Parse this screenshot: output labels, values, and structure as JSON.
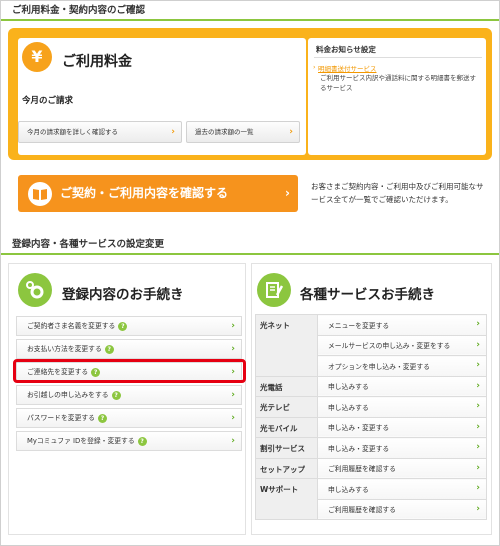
{
  "billing_section": {
    "title": "ご利用料金・契約内容のご確認",
    "card": {
      "icon": "yen-icon",
      "yen_symbol": "¥",
      "title": "ご利用料金",
      "subtitle": "今月のご請求",
      "buttons": [
        {
          "label": "今月の請求額を詳しく確認する"
        },
        {
          "label": "過去の請求額の一覧"
        }
      ]
    },
    "notice": {
      "title": "料金お知らせ設定",
      "link": "明細書送付サービス",
      "description": "ご利用サービス内訳や通話料に関する明細書を郵送するサービス"
    },
    "contract_button": {
      "label": "ご契約・ご利用内容を確認する",
      "icon": "book-icon"
    },
    "contract_note": "お客さまご契約内容・ご利用中及びご利用可能なサービス全てが一覧でご確認いただけます。"
  },
  "settings_section": {
    "title": "登録内容・各種サービスの設定変更",
    "registration": {
      "title": "登録内容のお手続き",
      "icon": "gear-icon",
      "help_mark": "?",
      "items": [
        {
          "label": "ご契約者さま名義を変更する"
        },
        {
          "label": "お支払い方法を変更する"
        },
        {
          "label": "ご連絡先を変更する"
        },
        {
          "label": "お引越しの申し込みをする"
        },
        {
          "label": "パスワードを変更する"
        },
        {
          "label": "Myコミュファ IDを登録・変更する"
        }
      ]
    },
    "services": {
      "title": "各種サービスお手続き",
      "icon": "pencil-note-icon",
      "groups": [
        {
          "name": "光ネット",
          "items": [
            "メニューを変更する",
            "メールサービスの申し込み・変更をする",
            "オプションを申し込み・変更する"
          ]
        },
        {
          "name": "光電話",
          "items": [
            "申し込みする"
          ]
        },
        {
          "name": "光テレビ",
          "items": [
            "申し込みする"
          ]
        },
        {
          "name": "光モバイル",
          "items": [
            "申し込み・変更する"
          ]
        },
        {
          "name": "割引サービス",
          "items": [
            "申し込み・変更する"
          ]
        },
        {
          "name": "セットアップ",
          "items": [
            "ご利用履歴を確認する"
          ]
        },
        {
          "name": "Wサポート",
          "items": [
            "申し込みする",
            "ご利用履歴を確認する"
          ]
        }
      ]
    }
  },
  "colors": {
    "accent_orange": "#f6931d",
    "accent_green": "#8cc63f",
    "highlight_red": "#e60012"
  }
}
